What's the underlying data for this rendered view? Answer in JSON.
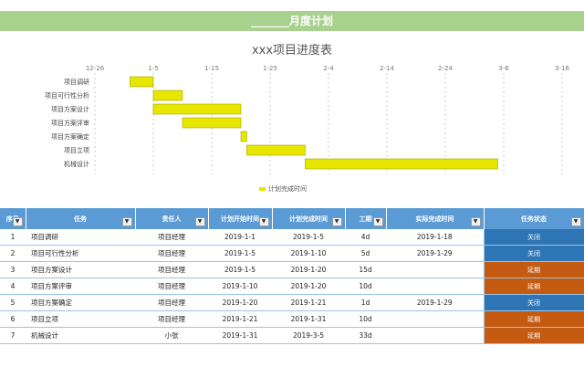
{
  "banner": "_______月度计划",
  "chart_data": {
    "type": "bar",
    "title": "xxx项目进度表",
    "x_ticks": [
      "12-26",
      "1-5",
      "1-15",
      "1-25",
      "2-4",
      "2-14",
      "2-24",
      "3-6",
      "3-16"
    ],
    "categories": [
      "项目调研",
      "项目可行性分析",
      "项目方案设计",
      "项目方案评审",
      "项目方案确定",
      "项目立项",
      "机械设计"
    ],
    "start": [
      "2019-01-01",
      "2019-01-05",
      "2019-01-05",
      "2019-01-10",
      "2019-01-20",
      "2019-01-21",
      "2019-01-31"
    ],
    "end": [
      "2019-01-05",
      "2019-01-10",
      "2019-01-20",
      "2019-01-20",
      "2019-01-21",
      "2019-01-31",
      "2019-03-05"
    ],
    "legend": "计划完成时间",
    "legend_position": "bottom",
    "bar_color": "#e6e600"
  },
  "table": {
    "headers": [
      "序号",
      "任务",
      "责任人",
      "计划开始时间",
      "计划完成时间",
      "工期",
      "实际完成时间",
      "任务状态"
    ],
    "rows": [
      {
        "no": "1",
        "task": "项目调研",
        "owner": "项目经理",
        "start": "2019-1-1",
        "end": "2019-1-5",
        "dur": "4d",
        "actual": "2019-1-18",
        "status": "关闭"
      },
      {
        "no": "2",
        "task": "项目可行性分析",
        "owner": "项目经理",
        "start": "2019-1-5",
        "end": "2019-1-10",
        "dur": "5d",
        "actual": "2019-1-29",
        "status": "关闭"
      },
      {
        "no": "3",
        "task": "项目方案设计",
        "owner": "项目经理",
        "start": "2019-1-5",
        "end": "2019-1-20",
        "dur": "15d",
        "actual": "",
        "status": "延期"
      },
      {
        "no": "4",
        "task": "项目方案评审",
        "owner": "项目经理",
        "start": "2019-1-10",
        "end": "2019-1-20",
        "dur": "10d",
        "actual": "",
        "status": "延期"
      },
      {
        "no": "5",
        "task": "项目方案确定",
        "owner": "项目经理",
        "start": "2019-1-20",
        "end": "2019-1-21",
        "dur": "1d",
        "actual": "2019-1-29",
        "status": "关闭"
      },
      {
        "no": "6",
        "task": "项目立项",
        "owner": "项目经理",
        "start": "2019-1-21",
        "end": "2019-1-31",
        "dur": "10d",
        "actual": "",
        "status": "延期"
      },
      {
        "no": "7",
        "task": "机械设计",
        "owner": "小张",
        "start": "2019-1-31",
        "end": "2019-3-5",
        "dur": "33d",
        "actual": "",
        "status": "延期"
      }
    ]
  },
  "colors": {
    "banner": "#a9d18e",
    "header": "#5b9bd5",
    "status_closed": "#2e75b6",
    "status_delayed": "#c55a11"
  },
  "icons": {
    "dropdown": "dropdown-arrow-icon"
  },
  "dropdown_glyph": "▼"
}
